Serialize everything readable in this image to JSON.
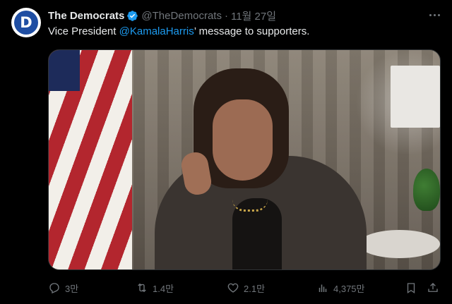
{
  "tweet": {
    "author_name": "The Democrats",
    "handle": "@TheDemocrats",
    "separator": "·",
    "date": "11월 27일",
    "text_prefix": "Vice President ",
    "mention": "@KamalaHarris",
    "text_suffix": "’ message to supporters.",
    "avatar_letter": "D",
    "accent_color": "#1d9bf0",
    "verified_color": "#1d9bf0"
  },
  "actions": {
    "replies": "3만",
    "retweets": "1.4만",
    "likes": "2.1만",
    "views": "4,375만"
  },
  "icons": {
    "reply": "reply-icon",
    "retweet": "retweet-icon",
    "like": "heart-icon",
    "views": "views-icon",
    "bookmark": "bookmark-icon",
    "share": "share-icon",
    "more": "more-icon"
  }
}
